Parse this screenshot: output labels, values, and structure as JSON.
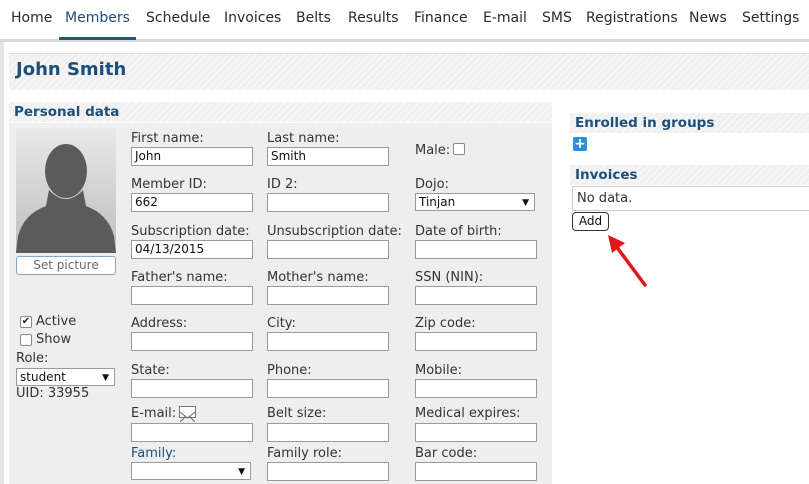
{
  "nav": {
    "items": [
      {
        "label": "Home"
      },
      {
        "label": "Members"
      },
      {
        "label": "Schedule"
      },
      {
        "label": "Invoices"
      },
      {
        "label": "Belts"
      },
      {
        "label": "Results"
      },
      {
        "label": "Finance"
      },
      {
        "label": "E-mail"
      },
      {
        "label": "SMS"
      },
      {
        "label": "Registrations"
      },
      {
        "label": "News"
      },
      {
        "label": "Settings"
      }
    ],
    "active": "Members"
  },
  "member": {
    "name": "John Smith"
  },
  "personal": {
    "heading": "Personal data",
    "set_picture": "Set picture",
    "active_label": "Active",
    "active_checked": true,
    "show_label": "Show",
    "show_checked": false,
    "role_label": "Role:",
    "role_value": "student",
    "uid": "UID: 33955",
    "fields": {
      "first_name": {
        "label": "First name:",
        "value": "John"
      },
      "last_name": {
        "label": "Last name:",
        "value": "Smith"
      },
      "male": {
        "label": "Male:"
      },
      "member_id": {
        "label": "Member ID:",
        "value": "662"
      },
      "id2": {
        "label": "ID 2:",
        "value": ""
      },
      "dojo": {
        "label": "Dojo:",
        "value": "Tinjan"
      },
      "subscription_date": {
        "label": "Subscription date:",
        "value": "04/13/2015"
      },
      "unsubscription_date": {
        "label": "Unsubscription date:",
        "value": ""
      },
      "date_of_birth": {
        "label": "Date of birth:",
        "value": ""
      },
      "fathers_name": {
        "label": "Father's name:",
        "value": ""
      },
      "mothers_name": {
        "label": "Mother's name:",
        "value": ""
      },
      "ssn": {
        "label": "SSN (NIN):",
        "value": ""
      },
      "address": {
        "label": "Address:",
        "value": ""
      },
      "city": {
        "label": "City:",
        "value": ""
      },
      "zip": {
        "label": "Zip code:",
        "value": ""
      },
      "state": {
        "label": "State:",
        "value": ""
      },
      "phone": {
        "label": "Phone:",
        "value": ""
      },
      "mobile": {
        "label": "Mobile:",
        "value": ""
      },
      "email": {
        "label": "E-mail:",
        "value": ""
      },
      "belt_size": {
        "label": "Belt size:",
        "value": ""
      },
      "medical_expires": {
        "label": "Medical expires:",
        "value": ""
      },
      "family": {
        "label": "Family:",
        "value": ""
      },
      "family_role": {
        "label": "Family role:",
        "value": ""
      },
      "bar_code": {
        "label": "Bar code:",
        "value": ""
      }
    }
  },
  "groups": {
    "heading": "Enrolled in groups",
    "add_icon": "+"
  },
  "invoices": {
    "heading": "Invoices",
    "empty": "No data.",
    "add": "Add"
  },
  "colors": {
    "accent": "#1d4f7b",
    "plus_blue": "#2a8fd6",
    "arrow_red": "#e0161b"
  }
}
